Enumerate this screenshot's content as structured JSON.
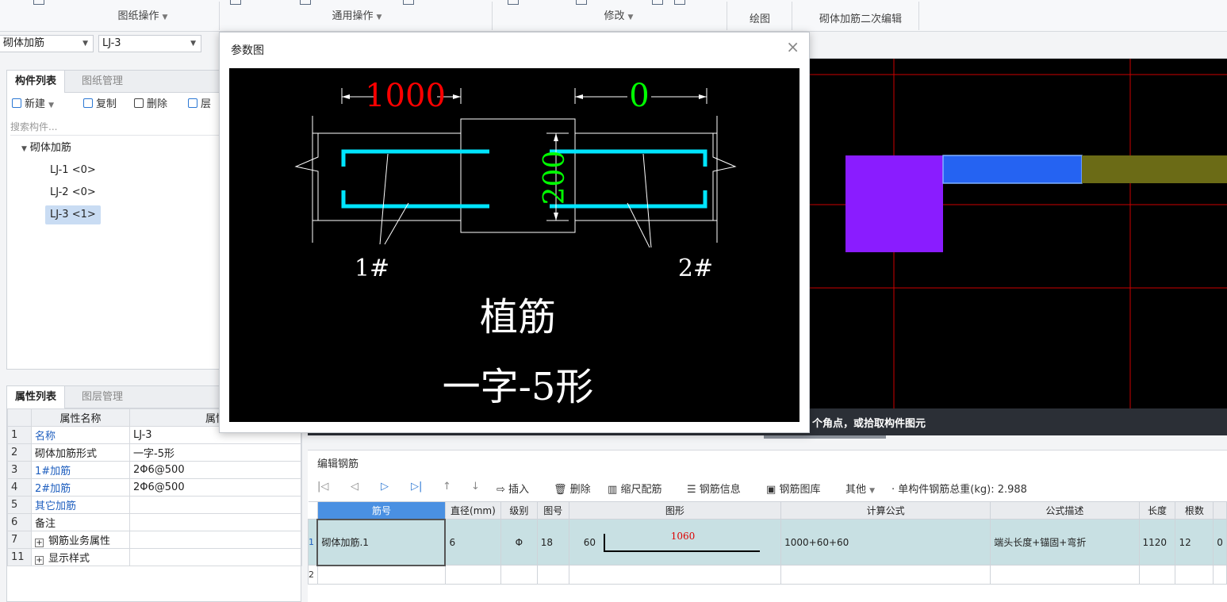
{
  "ribbon": {
    "groups": [
      "图纸操作",
      "通用操作",
      "修改",
      "绘图",
      "砌体加筋二次编辑"
    ]
  },
  "selectors": {
    "type": "砌体加筋",
    "component": "LJ-3"
  },
  "component_panel": {
    "tabs": [
      "构件列表",
      "图纸管理"
    ],
    "toolbar": {
      "new": "新建",
      "copy": "复制",
      "delete": "删除",
      "layer": "层"
    },
    "search_placeholder": "搜索构件...",
    "tree": {
      "root": "砌体加筋",
      "items": [
        "LJ-1 <0>",
        "LJ-2 <0>",
        "LJ-3 <1>"
      ]
    }
  },
  "property_panel": {
    "tabs": [
      "属性列表",
      "图层管理"
    ],
    "headers": [
      "属性名称",
      "属性"
    ],
    "rows": [
      {
        "n": "1",
        "name": "名称",
        "value": "LJ-3"
      },
      {
        "n": "2",
        "name": "砌体加筋形式",
        "value": "一字-5形"
      },
      {
        "n": "3",
        "name": "1#加筋",
        "value": "2Φ6@500"
      },
      {
        "n": "4",
        "name": "2#加筋",
        "value": "2Φ6@500"
      },
      {
        "n": "5",
        "name": "其它加筋",
        "value": ""
      },
      {
        "n": "6",
        "name": "备注",
        "value": ""
      },
      {
        "n": "7",
        "name": "钢筋业务属性",
        "value": ""
      },
      {
        "n": "11",
        "name": "显示样式",
        "value": ""
      }
    ]
  },
  "dialog": {
    "title": "参数图",
    "close": "×",
    "figure": {
      "dim_left": "1000",
      "dim_right": "0",
      "dim_vertical": "200",
      "label_1": "1#",
      "label_2": "2#",
      "caption_1": "植筋",
      "caption_2": "一字-5形"
    }
  },
  "canvas": {
    "status_text": "个角点，或拾取构件图元"
  },
  "rebar_editor": {
    "title": "编辑钢筋",
    "toolbar": {
      "insert": "插入",
      "delete": "删除",
      "scale": "缩尺配筋",
      "info": "钢筋信息",
      "library": "钢筋图库",
      "other": "其他",
      "total_label": "单构件钢筋总重(kg): 2.988"
    },
    "headers": [
      "筋号",
      "直径(mm)",
      "级别",
      "图号",
      "图形",
      "计算公式",
      "公式描述",
      "长度",
      "根数"
    ],
    "rows": [
      {
        "id": "1",
        "name": "砌体加筋.1",
        "diameter": "6",
        "grade": "Φ",
        "shape_no": "18",
        "shape_left": "60",
        "shape_mid": "1060",
        "formula": "1000+60+60",
        "desc": "端头长度+锚固+弯折",
        "length": "1120",
        "count": "12",
        "extra": "0"
      }
    ],
    "empty_row_id": "2"
  },
  "colors": {
    "dim_red": "#ff0000",
    "dim_green": "#00ff00",
    "rebar_cyan": "#00e5ff",
    "purple": "#8a1cff",
    "blue_block": "#2563f2",
    "olive": "#6b6b16",
    "grid_red": "#cc0000"
  }
}
